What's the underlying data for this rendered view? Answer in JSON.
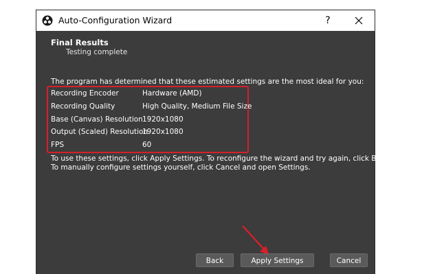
{
  "window": {
    "title": "Auto-Configuration Wizard",
    "help_label": "?",
    "close_label": "×"
  },
  "section": {
    "title": "Final Results",
    "subtitle": "Testing complete"
  },
  "intro_text": "The program has determined that these estimated settings are the most ideal for you:",
  "results": [
    {
      "label": "Recording Encoder",
      "value": "Hardware (AMD)"
    },
    {
      "label": "Recording Quality",
      "value": "High Quality, Medium File Size"
    },
    {
      "label": "Base (Canvas) Resolution",
      "value": "1920x1080"
    },
    {
      "label": "Output (Scaled) Resolution",
      "value": "1920x1080"
    },
    {
      "label": "FPS",
      "value": "60"
    }
  ],
  "apply_note": {
    "line1": "To use these settings, click Apply Settings.  To reconfigure the wizard and try again, click Back.",
    "line2": "To manually configure settings yourself, click Cancel and open Settings."
  },
  "buttons": {
    "back": "Back",
    "apply": "Apply Settings",
    "cancel": "Cancel"
  },
  "colors": {
    "highlight": "#d6202a",
    "dialog_bg": "#3c3c3c",
    "button_bg": "#5a5a5a"
  }
}
